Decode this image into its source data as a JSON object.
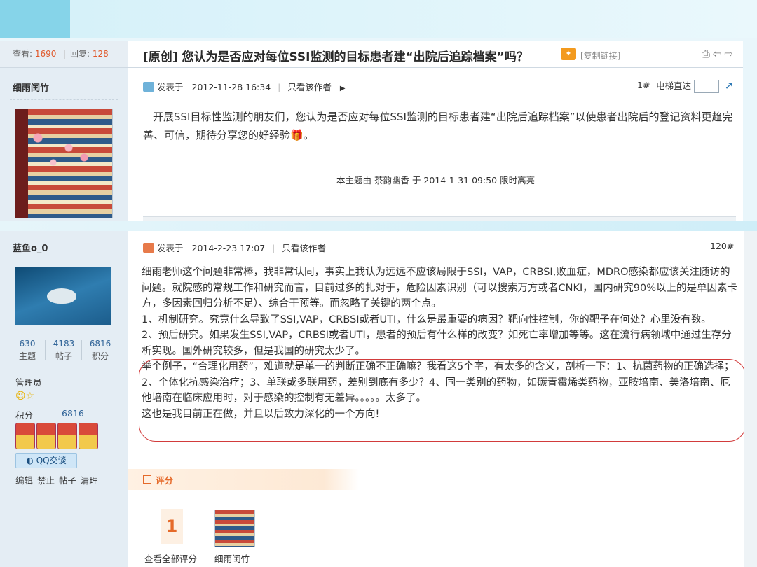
{
  "thread": {
    "views_label": "查看:",
    "views": "1690",
    "replies_label": "回复:",
    "replies": "128",
    "title": "[原创] 您认为是否应对每位SSI监测的目标患者建“出院后追踪档案”吗？",
    "copy_link": "[复制链接]"
  },
  "post1": {
    "author": "细雨闰竹",
    "posted_label": "发表于",
    "time": "2012-11-28 16:34",
    "only_author": "只看该作者",
    "floor": "1#",
    "elevator_label": "电梯直达",
    "body": "开展SSI目标性监测的朋友们，您认为是否应对每位SSI监测的目标患者建“出院后追踪档案”以使患者出院后的登记资料更趋完善、可信，期待分享您的好经验",
    "highlight_note": "本主题由  茶韵幽香  于  2014-1-31 09:50 限时高亮"
  },
  "post2": {
    "author": "蓝鱼o_0",
    "posted_label": "发表于",
    "time": "2014-2-23 17:07",
    "only_author": "只看该作者",
    "floor": "120#",
    "stats": [
      {
        "value": "630",
        "label": "主题"
      },
      {
        "value": "4183",
        "label": "帖子"
      },
      {
        "value": "6816",
        "label": "积分"
      }
    ],
    "role": "管理员",
    "score_label": "积分",
    "score_value": "6816",
    "qq_label": "QQ交谈",
    "admin_links": "编辑 禁止 帖子 清理",
    "paragraphs": [
      "细雨老师这个问题非常棒，我非常认同，事实上我认为远远不应该局限于SSI，VAP，CRBSI,败血症，MDRO感染都应该关注随访的问题。就院感的常规工作和研究而言，目前过多的扎对于，危险因素识别（可以搜索万方或者CNKI，国内研究90%以上的是单因素卡方，多因素回归分析不足）、综合干预等。而忽略了关键的两个点。",
      "1、机制研究。究竟什么导致了SSI,VAP，CRBSI或者UTI，什么是最重要的病因？靶向性控制，你的靶子在何处？心里没有数。",
      "2、预后研究。如果发生SSI,VAP，CRBSI或者UTI，患者的预后有什么样的改变？如死亡率增加等等。这在流行病领域中通过生存分析实现。国外研究较多，但是我国的研究太少了。",
      "举个例子，“合理化用药”，难道就是单一的判断正确不正确嘛？我看这5个字，有太多的含义，剖析一下：1、抗菌药物的正确选择；2、个体化抗感染治疗；3、单联或多联用药，差别到底有多少？4、同一类别的药物，如碳青霉烯类药物，亚胺培南、美洛培南、厄他培南在临床应用时，对于感染的控制有无差异。。。。。太多了。",
      "这也是我目前正在做，并且以后致力深化的一个方向!"
    ],
    "rating_label": "评分",
    "rating_count": "1",
    "view_all_ratings": "查看全部评分",
    "rater_name": "细雨闰竹"
  }
}
